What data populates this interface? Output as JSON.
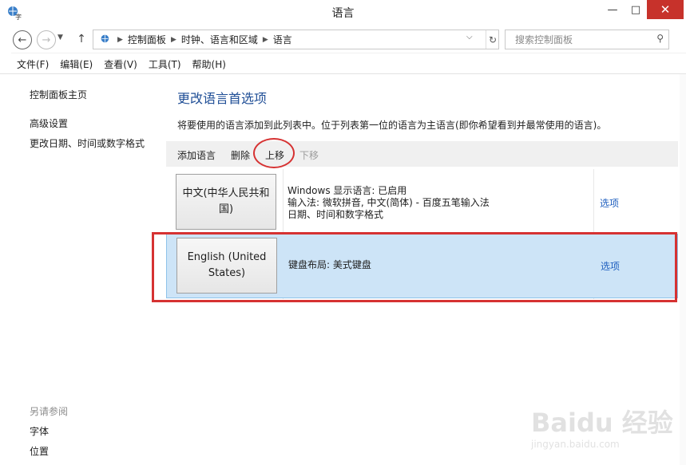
{
  "window": {
    "title": "语言"
  },
  "address": {
    "crumbs": [
      "控制面板",
      "时钟、语言和区域",
      "语言"
    ],
    "search_placeholder": "搜索控制面板"
  },
  "menu": [
    "文件(F)",
    "编辑(E)",
    "查看(V)",
    "工具(T)",
    "帮助(H)"
  ],
  "left_pane": {
    "home": "控制面板主页",
    "advanced": "高级设置",
    "date_format": "更改日期、时间或数字格式",
    "see_also": "另请参阅",
    "fonts": "字体",
    "location": "位置"
  },
  "main": {
    "title": "更改语言首选项",
    "description": "将要使用的语言添加到此列表中。位于列表第一位的语言为主语言(即你希望看到并最常使用的语言)。",
    "toolbar": {
      "add": "添加语言",
      "remove": "删除",
      "move_up": "上移",
      "move_down": "下移"
    },
    "languages": [
      {
        "name": "中文(中华人民共和国)",
        "info": [
          "Windows 显示语言: 已启用",
          "输入法: 微软拼音, 中文(简体) - 百度五笔输入法",
          "日期、时间和数字格式"
        ],
        "options": "选项"
      },
      {
        "name": "English (United States)",
        "info": [
          "键盘布局: 美式键盘"
        ],
        "options": "选项",
        "selected": true
      }
    ]
  },
  "watermark": {
    "brand": "Baidu 经验",
    "site": "jingyan.baidu.com"
  },
  "colors": {
    "highlight_red": "#d63232",
    "selected_row": "#cde4f7",
    "link_blue": "#1f5fbf",
    "title_blue": "#1f4e96",
    "close_red": "#c7322b"
  }
}
